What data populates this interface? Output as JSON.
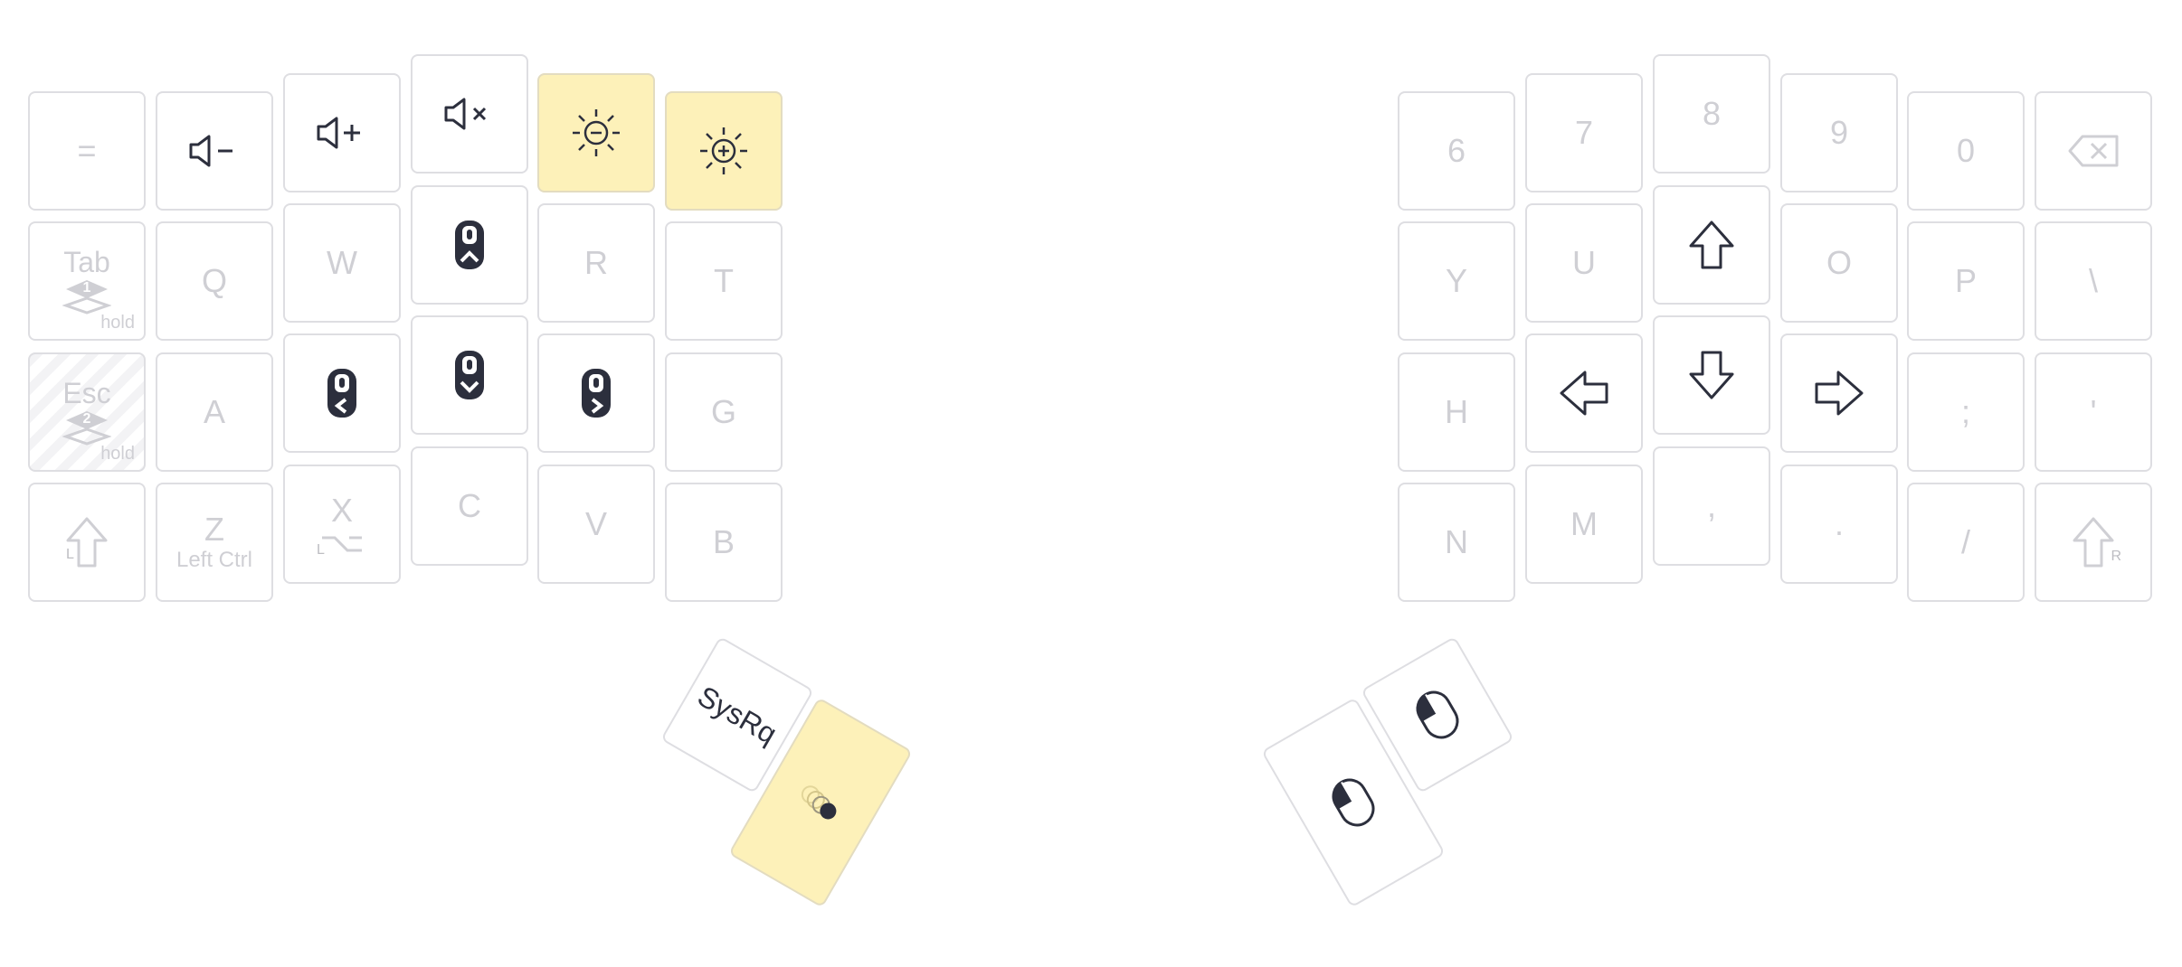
{
  "left": {
    "row0": [
      "=",
      "volume-down-icon",
      "volume-up-icon",
      "volume-mute-icon",
      "brightness-down-icon",
      "brightness-up-icon"
    ],
    "row1": {
      "tab": "Tab",
      "tab_layer": "1",
      "tab_hold": "hold",
      "q": "Q",
      "w": "W",
      "mouse_up": "mouse-move-up-icon",
      "r": "R",
      "t": "T"
    },
    "row2": {
      "esc": "Esc",
      "esc_layer": "2",
      "esc_hold": "hold",
      "a": "A",
      "mouse_left": "mouse-move-left-icon",
      "mouse_down": "mouse-move-down-icon",
      "mouse_right": "mouse-move-right-icon",
      "g": "G"
    },
    "row3": {
      "shift_side": "L",
      "z": "Z",
      "z_sub": "Left Ctrl",
      "x": "X",
      "x_side": "L",
      "c": "C",
      "v": "V",
      "b": "B"
    },
    "thumb": {
      "sysrq": "SysRq",
      "accel": "mouse-acceleration-icon"
    }
  },
  "right": {
    "row0": [
      "6",
      "7",
      "8",
      "9",
      "0"
    ],
    "row1": {
      "y": "Y",
      "u": "U",
      "up": "arrow-up-icon",
      "o": "O",
      "p": "P",
      "backslash": "\\"
    },
    "row2": {
      "h": "H",
      "left": "arrow-left-icon",
      "down": "arrow-down-icon",
      "right": "arrow-right-icon",
      "semicolon": ";",
      "quote": "'"
    },
    "row3": {
      "n": "N",
      "m": "M",
      "comma": ",",
      "period": ".",
      "slash": "/",
      "shift_side": "R"
    },
    "thumb": {
      "left_click": "mouse-left-click-icon",
      "right_click": "mouse-right-click-icon"
    }
  },
  "colors": {
    "highlight": "#fdf1b9",
    "border": "#dedee2",
    "inactive": "#cfcfd4",
    "active": "#2c2f3d"
  }
}
